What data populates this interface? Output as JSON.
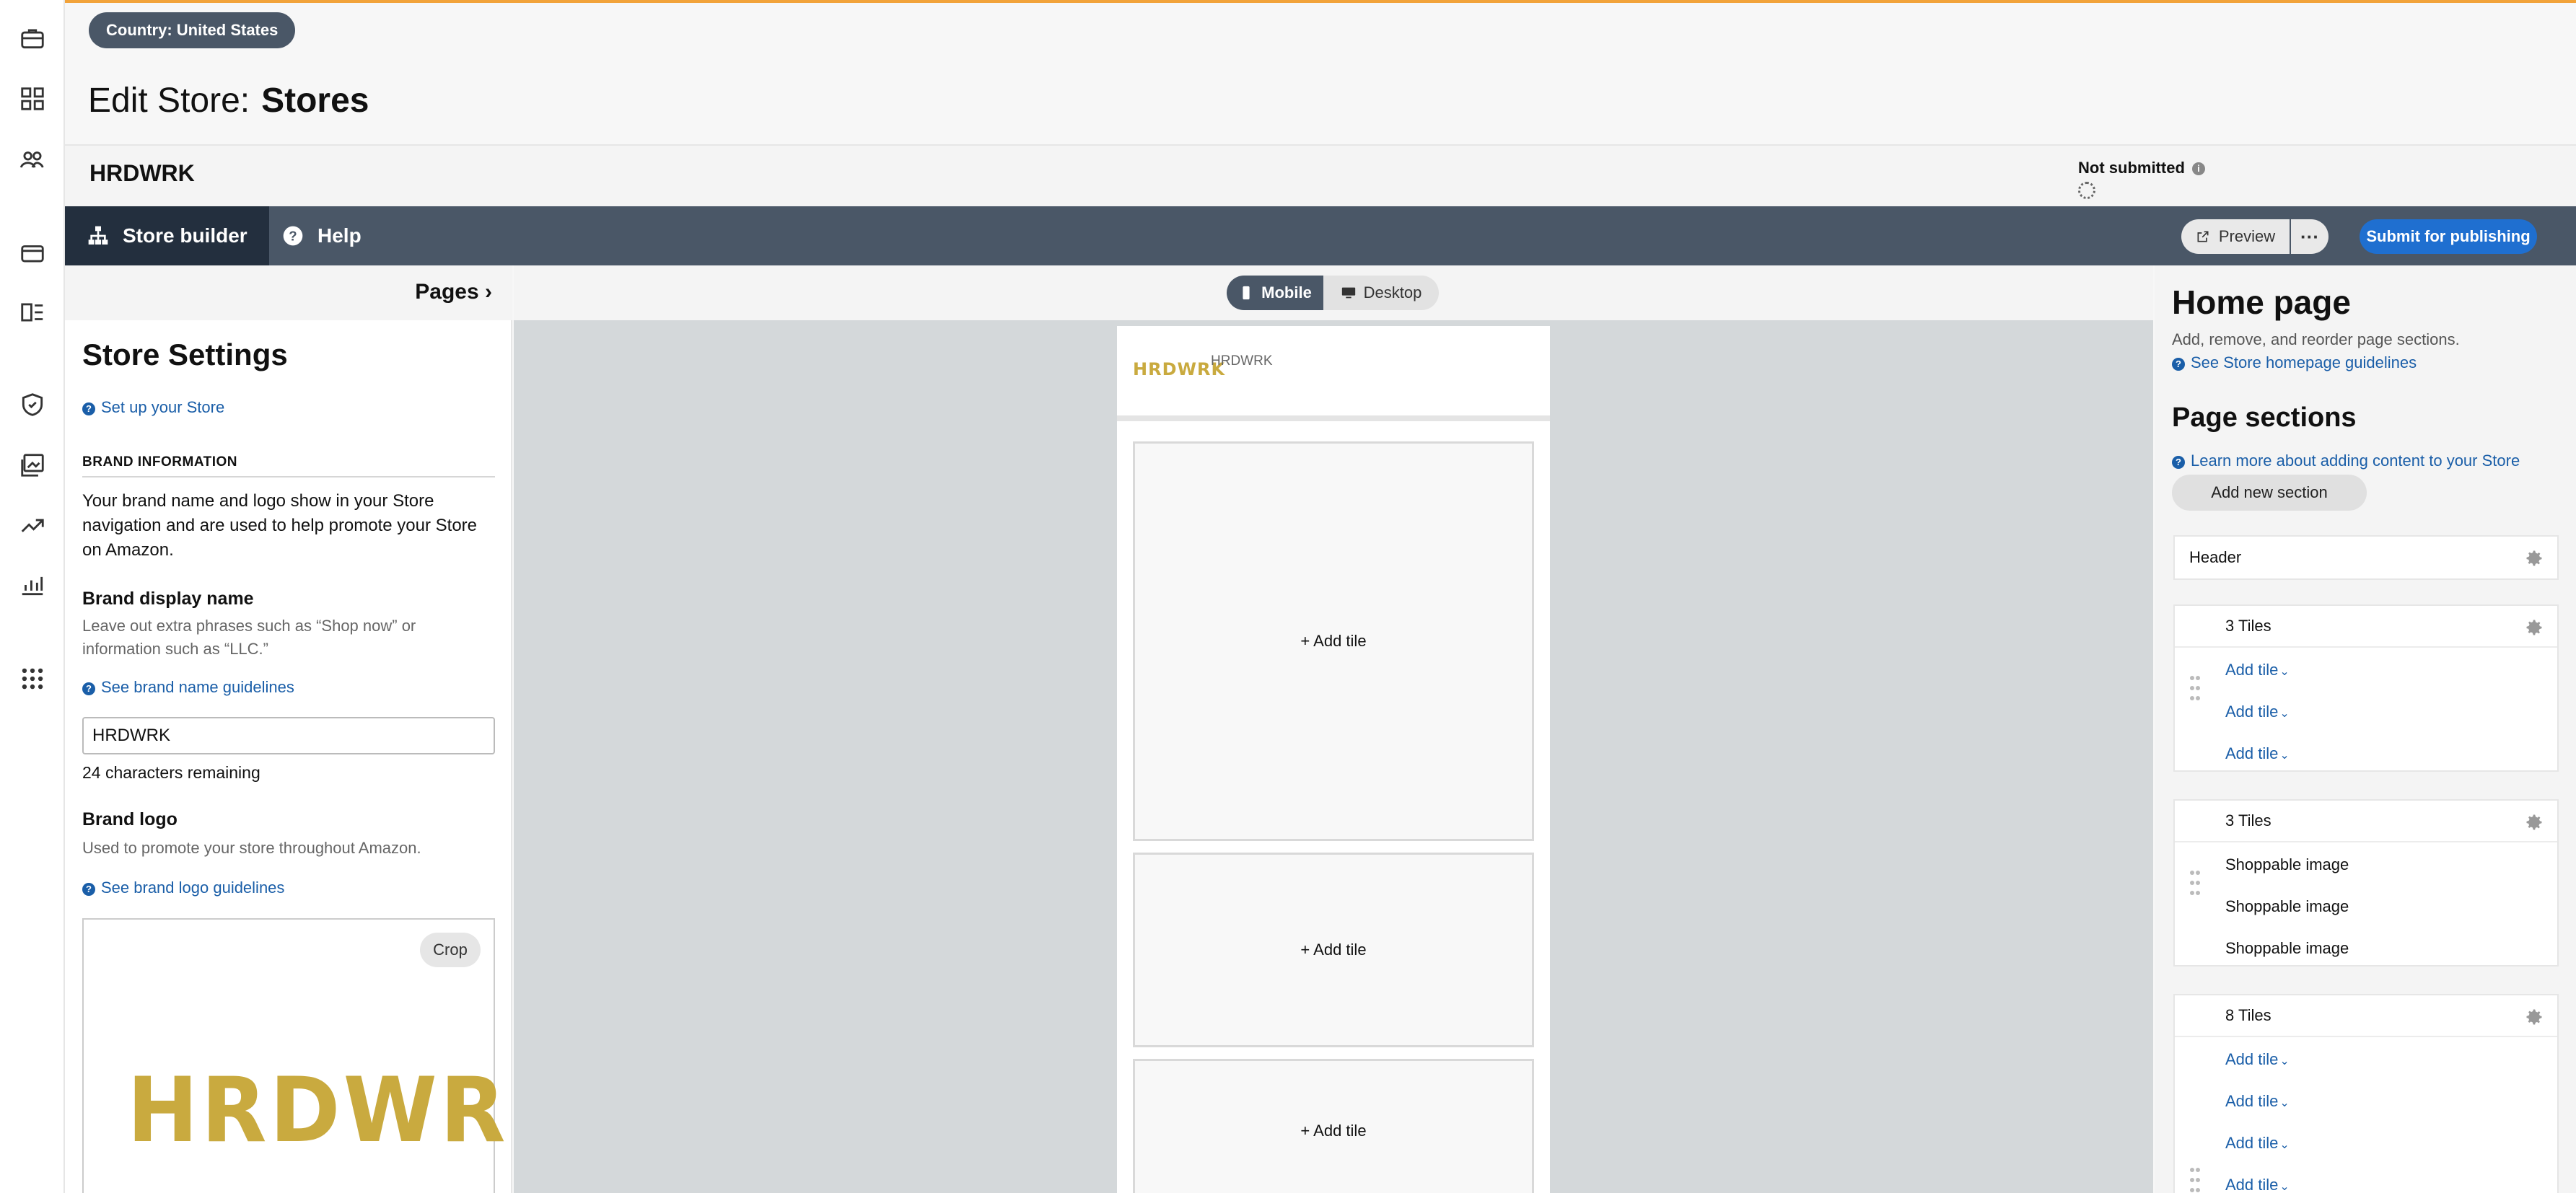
{
  "header": {
    "country_pill": "Country: United States",
    "edit_prefix": "Edit Store:",
    "edit_name": "Stores",
    "brand": "HRDWRK",
    "status": "Not submitted"
  },
  "toolbar": {
    "tab_store_builder": "Store builder",
    "tab_help": "Help",
    "preview": "Preview",
    "more": "···",
    "submit": "Submit for publishing"
  },
  "left_panel": {
    "pages": "Pages",
    "title": "Store Settings",
    "setup_link": "Set up your Store",
    "section_label": "BRAND INFORMATION",
    "brand_info_text": "Your brand name and logo show in your Store navigation and are used to help promote your Store on Amazon.",
    "display_name_label": "Brand display name",
    "display_name_help": "Leave out extra phrases such as “Shop now” or information such as “LLC.”",
    "brand_name_guidelines": "See brand name guidelines",
    "brand_name_value": "HRDWRK",
    "chars_remaining": "24 characters remaining",
    "logo_label": "Brand logo",
    "logo_help": "Used to promote your store throughout Amazon.",
    "logo_guidelines": "See brand logo guidelines",
    "crop": "Crop",
    "logo_wordmark": "HRDWRK"
  },
  "canvas": {
    "mobile": "Mobile",
    "desktop": "Desktop",
    "phone_logo": "HRDWRK",
    "phone_brand": "HRDWRK",
    "add_tile": "+ Add tile"
  },
  "right_panel": {
    "title": "Home page",
    "subtitle": "Add, remove, and reorder page sections.",
    "guidelines_link": "See Store homepage guidelines",
    "sections_title": "Page sections",
    "learn_link": "Learn more about adding content to your Store",
    "add_section": "Add new section",
    "header_card": "Header",
    "card1": {
      "title": "3 Tiles",
      "rows": [
        "Add tile",
        "Add tile",
        "Add tile"
      ]
    },
    "card2": {
      "title": "3 Tiles",
      "rows": [
        "Shoppable image",
        "Shoppable image",
        "Shoppable image"
      ]
    },
    "card3": {
      "title": "8 Tiles",
      "rows": [
        "Add tile",
        "Add tile",
        "Add tile",
        "Add tile"
      ]
    }
  },
  "colors": {
    "navy": "#232f3e",
    "slate": "#4a5767",
    "link_blue": "#1a5ea8",
    "submit_blue": "#1f6fd0",
    "logo_gold": "#c9aa3f",
    "accent_orange": "#f2a33a"
  }
}
